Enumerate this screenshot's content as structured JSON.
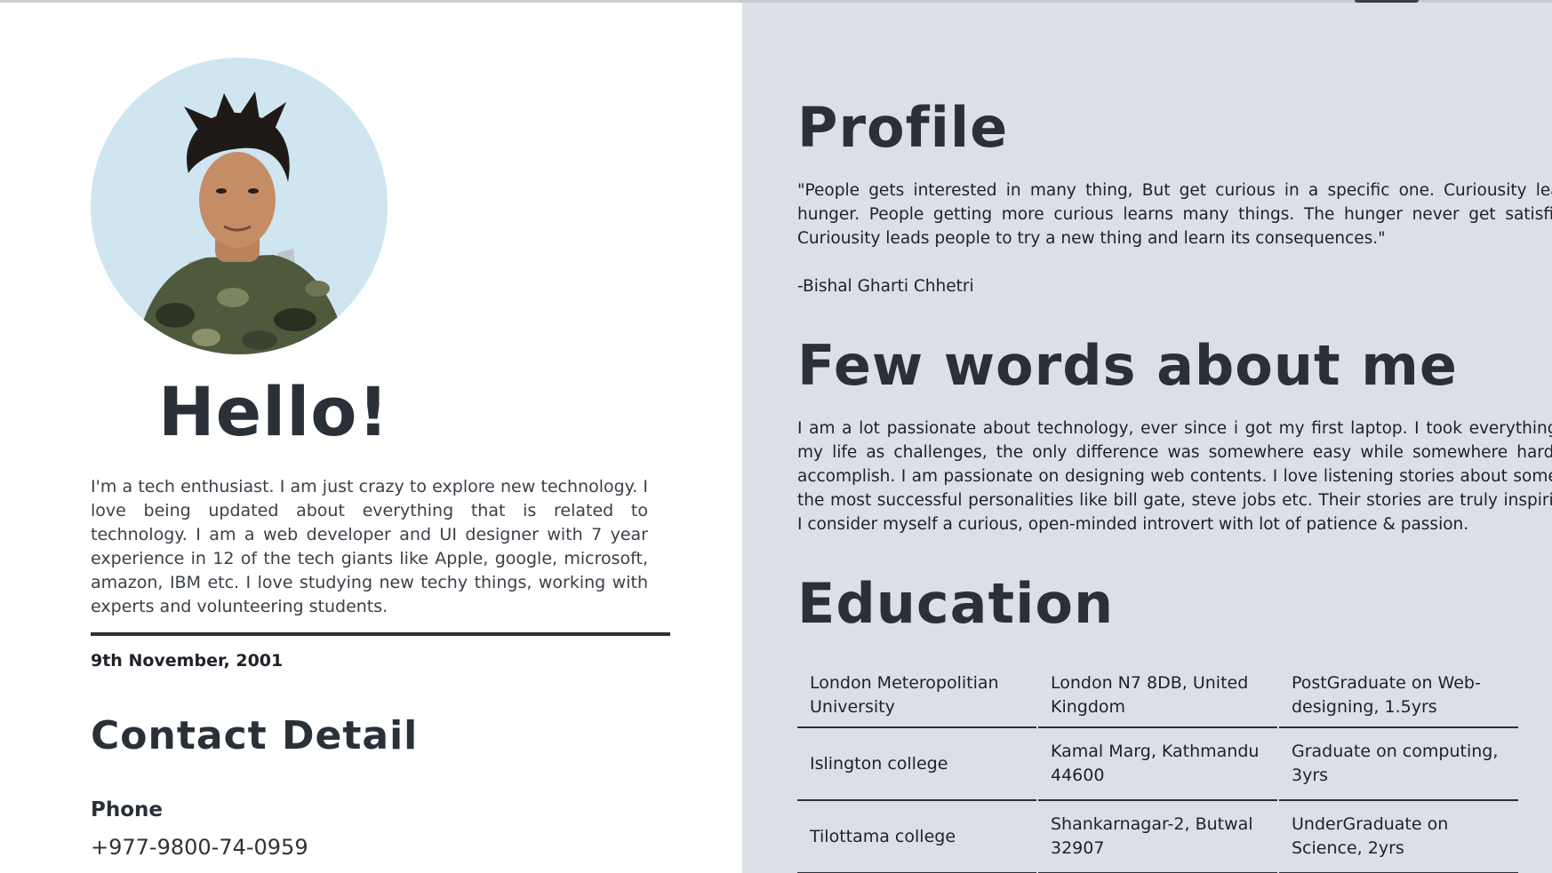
{
  "left": {
    "avatar_alt": "profile photo",
    "greeting": "Hello!",
    "intro": "I'm a tech enthusiast. I am just crazy to explore new technology. I love being updated about everything that is related to technology. I am a web developer and UI designer with 7 year experience in 12 of the tech giants like Apple, google, microsoft, amazon, IBM etc. I love studying new techy things, working with experts and volunteering students.",
    "dob": "9th November, 2001",
    "contact_title": "Contact Detail",
    "phone_label": "Phone",
    "phone_value": "+977-9800-74-0959"
  },
  "right": {
    "profile_title": "Profile",
    "profile_quote": "\"People gets interested in many thing, But get curious in a specific one. Curiousity leads hunger. People getting more curious learns many things. The hunger never get satisfied. Curiousity leads people to try a new thing and learn its consequences.\"",
    "profile_author": "-Bishal Gharti Chhetri",
    "about_title": "Few words about me",
    "about_text": "I am a lot passionate about technology, ever since i got my first laptop. I took everything in my life as challenges, the only difference was somewhere easy while somewhere hard to accomplish. I am passionate on designing web contents. I love listening stories about some of the most successful personalities like bill gate, steve jobs etc. Their stories are truly inspiring. I consider myself a curious, open-minded introvert with lot of patience & passion.",
    "education_title": "Education",
    "education": [
      [
        "London Meteropolitian University",
        "London N7 8DB, United Kingdom",
        "PostGraduate on Web-designing, 1.5yrs"
      ],
      [
        "Islington college",
        "Kamal Marg, Kathmandu 44600",
        "Graduate on computing, 3yrs"
      ],
      [
        "Tilottama college",
        "Shankarnagar-2, Butwal 32907",
        "UnderGraduate on Science, 2yrs"
      ]
    ]
  },
  "colors": {
    "text_dark": "#293038",
    "right_bg": "#dcdfe6",
    "avatar_bg": "#cfe6f1"
  }
}
